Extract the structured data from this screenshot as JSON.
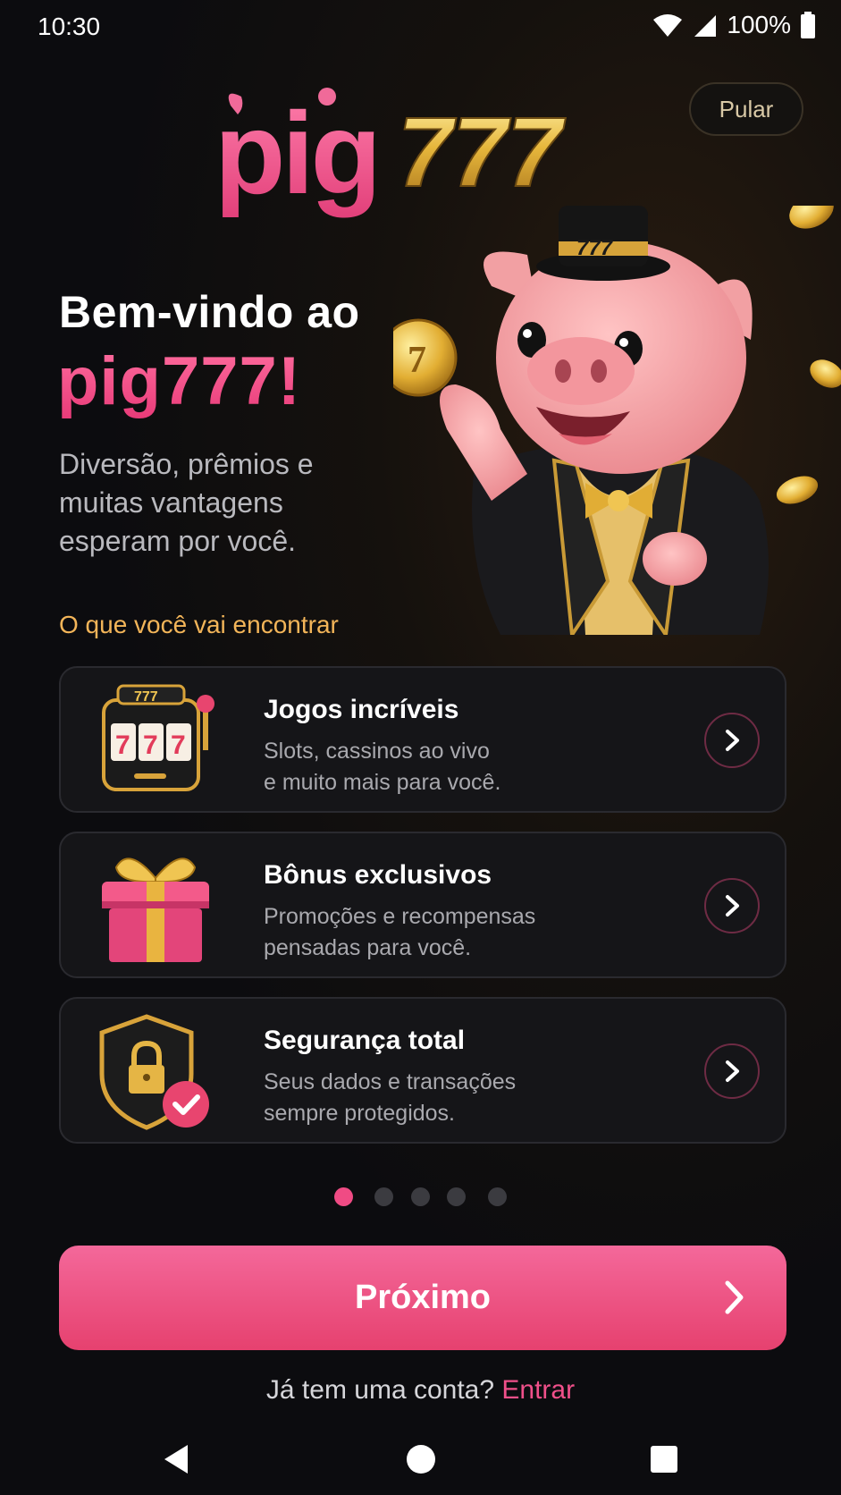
{
  "status_bar": {
    "time": "10:30",
    "battery": "100%"
  },
  "header": {
    "logo_text": "pig777",
    "skip_label": "Pular"
  },
  "hero": {
    "welcome": "Bem-vindo ao",
    "brand": "pig777!",
    "subtitle": "Diversão, prêmios e muitas vantagens esperam por você."
  },
  "features": {
    "section_title": "O que você vai encontrar",
    "items": [
      {
        "icon": "slot-machine-icon",
        "title": "Jogos incríveis",
        "line1": "Slots, cassinos ao vivo",
        "line2": "e muito mais para você."
      },
      {
        "icon": "gift-icon",
        "title": "Bônus exclusivos",
        "line1": "Promoções e recompensas",
        "line2": "pensadas para você."
      },
      {
        "icon": "shield-lock-icon",
        "title": "Segurança total",
        "line1": "Seus dados e transações",
        "line2": "sempre protegidos."
      }
    ]
  },
  "pagination": {
    "total": 5,
    "active": 1
  },
  "cta": {
    "next_label": "Próximo"
  },
  "login": {
    "prompt": "Já tem uma conta?",
    "link": "Entrar"
  },
  "colors": {
    "accent": "#f04b84",
    "gold": "#f3b559",
    "background": "#0c0c0f"
  }
}
